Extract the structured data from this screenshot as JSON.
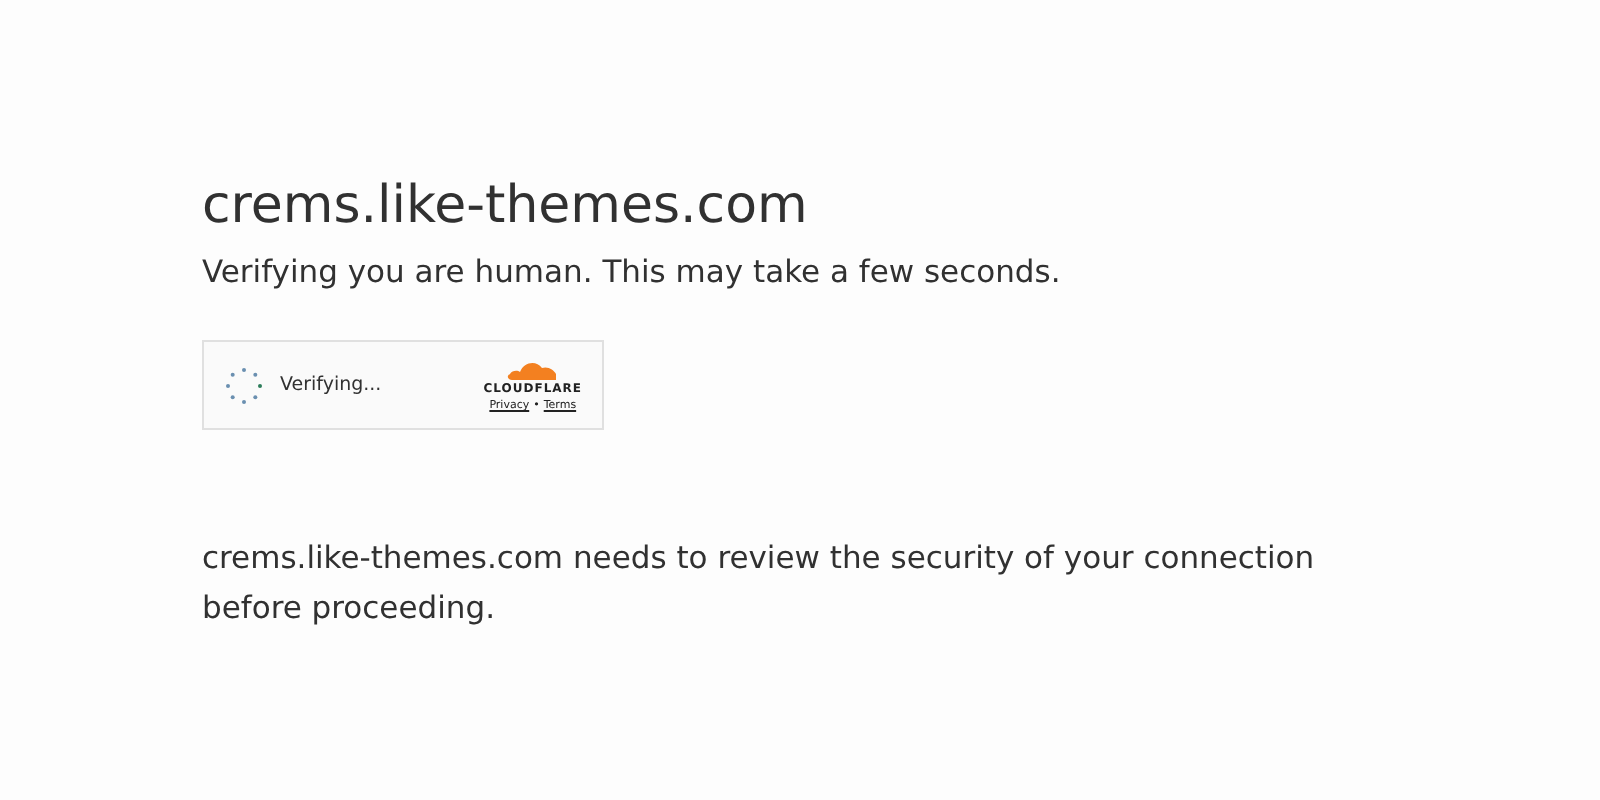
{
  "heading": "crems.like-themes.com",
  "subtitle": "Verifying you are human. This may take a few seconds.",
  "widget": {
    "status": "Verifying...",
    "brand": "CLOUDFLARE",
    "links": [
      {
        "label": "Privacy"
      },
      {
        "label": "Terms"
      }
    ],
    "separator": "•"
  },
  "message": "crems.like-themes.com needs to review the security of your connection before proceeding."
}
